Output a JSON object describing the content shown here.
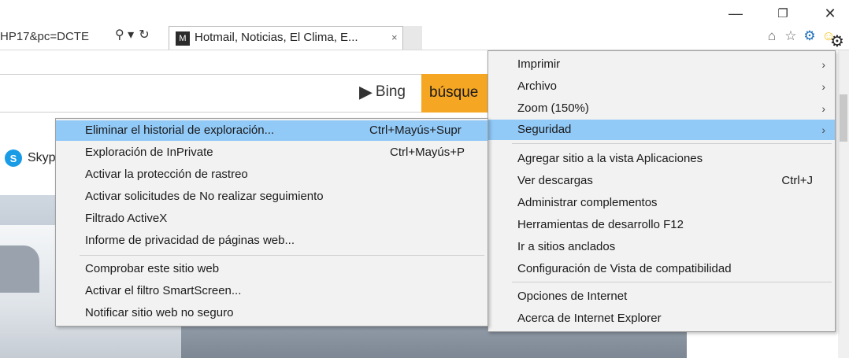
{
  "window": {
    "minimize_glyph": "—",
    "restore_glyph": "❐",
    "close_glyph": "✕"
  },
  "address_bar": {
    "url_fragment": "HP17&pc=DCTE",
    "search_glyph": "⚲ ▾",
    "refresh_glyph": "↻"
  },
  "tab": {
    "title": "Hotmail, Noticias, El Clima, E...",
    "close_glyph": "×",
    "icon": "msn-butterfly-icon",
    "icon_glyph": "M"
  },
  "toolbar_icons": {
    "home_glyph": "⌂",
    "favorites_glyph": "☆",
    "tools_glyph": "⚙",
    "smiley_glyph": "☺"
  },
  "page": {
    "bing_logo_b": "▶",
    "bing_label": "Bing",
    "search_button_label": "búsque",
    "skype_icon_glyph": "S",
    "skype_label": "Skyp",
    "gear_glyph": "⚙"
  },
  "tools_menu": {
    "items": [
      {
        "label": "Imprimir",
        "shortcut": "",
        "arrow": "›"
      },
      {
        "label": "Archivo",
        "shortcut": "",
        "arrow": "›"
      },
      {
        "label": "Zoom (150%)",
        "shortcut": "",
        "arrow": "›"
      },
      {
        "label": "Seguridad",
        "shortcut": "",
        "arrow": "›"
      },
      {
        "label": "Agregar sitio a la vista Aplicaciones",
        "shortcut": "",
        "arrow": ""
      },
      {
        "label": "Ver descargas",
        "shortcut": "Ctrl+J",
        "arrow": ""
      },
      {
        "label": "Administrar complementos",
        "shortcut": "",
        "arrow": ""
      },
      {
        "label": "Herramientas de desarrollo F12",
        "shortcut": "",
        "arrow": ""
      },
      {
        "label": "Ir a sitios anclados",
        "shortcut": "",
        "arrow": ""
      },
      {
        "label": "Configuración de Vista de compatibilidad",
        "shortcut": "",
        "arrow": ""
      },
      {
        "label": "Opciones de Internet",
        "shortcut": "",
        "arrow": ""
      },
      {
        "label": "Acerca de Internet Explorer",
        "shortcut": "",
        "arrow": ""
      }
    ],
    "highlighted": "Seguridad"
  },
  "security_submenu": {
    "items": [
      {
        "label": "Eliminar el historial de exploración...",
        "shortcut": "Ctrl+Mayús+Supr"
      },
      {
        "label": "Exploración de InPrivate",
        "shortcut": "Ctrl+Mayús+P"
      },
      {
        "label": "Activar la protección de rastreo",
        "shortcut": ""
      },
      {
        "label": "Activar solicitudes de No realizar seguimiento",
        "shortcut": ""
      },
      {
        "label": "Filtrado ActiveX",
        "shortcut": ""
      },
      {
        "label": "Informe de privacidad de páginas web...",
        "shortcut": ""
      },
      {
        "label": "Comprobar este sitio web",
        "shortcut": ""
      },
      {
        "label": "Activar el filtro SmartScreen...",
        "shortcut": ""
      },
      {
        "label": "Notificar sitio web no seguro",
        "shortcut": ""
      }
    ],
    "highlighted": "Eliminar el historial de exploración..."
  },
  "colors": {
    "menu_background": "#f2f2f2",
    "highlight": "#91c9f7",
    "search_button": "#f5a623",
    "skype_blue": "#1a9be6",
    "tools_gear_blue": "#1e6fb8",
    "smiley_yellow": "#f2c21b"
  }
}
